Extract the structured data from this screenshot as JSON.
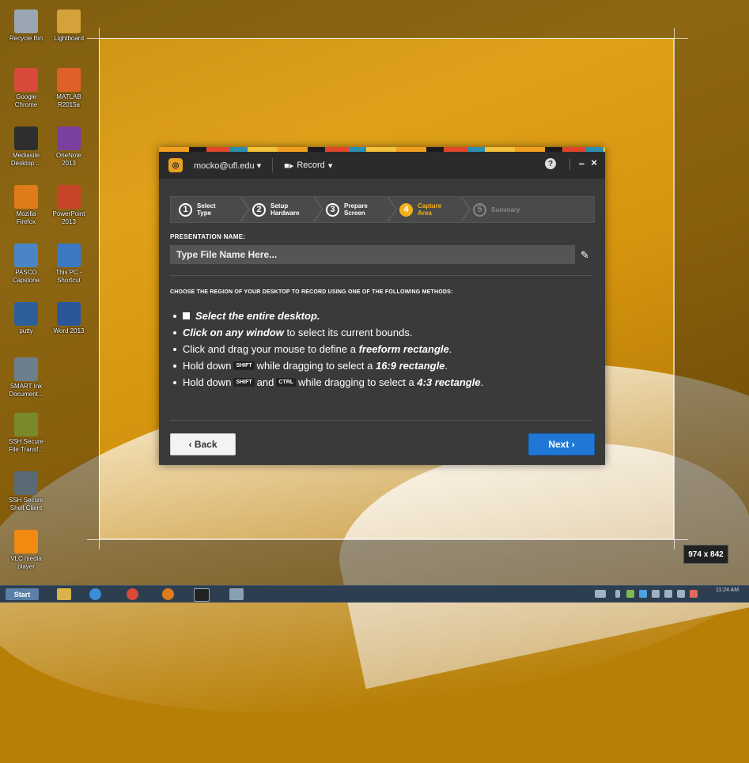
{
  "selection": {
    "size_label": "974 x 842"
  },
  "desktop_icons": [
    {
      "label": "Recycle Bin",
      "color": "#9aa7b2"
    },
    {
      "label": "Lightboard",
      "color": "#d4a23a"
    },
    {
      "label": "Google Chrome",
      "color": "#d84a3a"
    },
    {
      "label": "MATLAB R2015a",
      "color": "#e0602a"
    },
    {
      "label": "Mediasite Desktop ...",
      "color": "#2e2e2e"
    },
    {
      "label": "OneNote 2013",
      "color": "#7b3fa0"
    },
    {
      "label": "Mozilla Firefox",
      "color": "#e07b1a"
    },
    {
      "label": "PowerPoint 2013",
      "color": "#c8452a"
    },
    {
      "label": "PASCO Capstone",
      "color": "#4a86c5"
    },
    {
      "label": "This PC - Shortcut",
      "color": "#3a78c2"
    },
    {
      "label": "putty",
      "color": "#2d5f9a"
    },
    {
      "label": "Word 2013",
      "color": "#2b579a"
    },
    {
      "label": "SMART Ink Document...",
      "color": "#6d7f8c"
    },
    {
      "label": "SSH Secure File Transf...",
      "color": "#7a8a2a"
    },
    {
      "label": "SSH Secure Shell Client",
      "color": "#5a6a74"
    },
    {
      "label": "VLC media player",
      "color": "#f08a10"
    }
  ],
  "taskbar": {
    "start_label": "Start",
    "clock": "11:24 AM"
  },
  "app": {
    "account": "mocko@ufl.edu",
    "record_menu": "Record",
    "help": "?",
    "minimize": "–",
    "close": "×",
    "steps": [
      {
        "num": "1",
        "line1": "Select",
        "line2": "Type",
        "state": "done"
      },
      {
        "num": "2",
        "line1": "Setup",
        "line2": "Hardware",
        "state": "done"
      },
      {
        "num": "3",
        "line1": "Prepare",
        "line2": "Screen",
        "state": "done"
      },
      {
        "num": "4",
        "line1": "Capture",
        "line2": "Area",
        "state": "active"
      },
      {
        "num": "5",
        "line1": "Summary",
        "line2": "",
        "state": "inactive"
      }
    ],
    "presentation_label": "PRESENTATION NAME:",
    "presentation_placeholder": "Type File Name Here...",
    "choose_text": "CHOOSE THE REGION OF YOUR DESKTOP TO RECORD USING ONE OF THE FOLLOWING METHODS:",
    "methods": {
      "m1": "Select the entire desktop.",
      "m2a": "Click on any window",
      "m2b": " to select its current bounds.",
      "m3a": "Click and drag your mouse to define a ",
      "m3b": "freeform rectangle",
      "m3c": ".",
      "m4a": "Hold down",
      "m4key": "SHIFT",
      "m4b": "while dragging to select a ",
      "m4c": "16:9 rectangle",
      "m4d": ".",
      "m5a": "Hold down",
      "m5key1": "SHIFT",
      "m5b": "and",
      "m5key2": "CTRL",
      "m5c": "while dragging to select a ",
      "m5d": "4:3 rectangle",
      "m5e": "."
    },
    "back_label": "‹ Back",
    "next_label": "Next ›"
  }
}
